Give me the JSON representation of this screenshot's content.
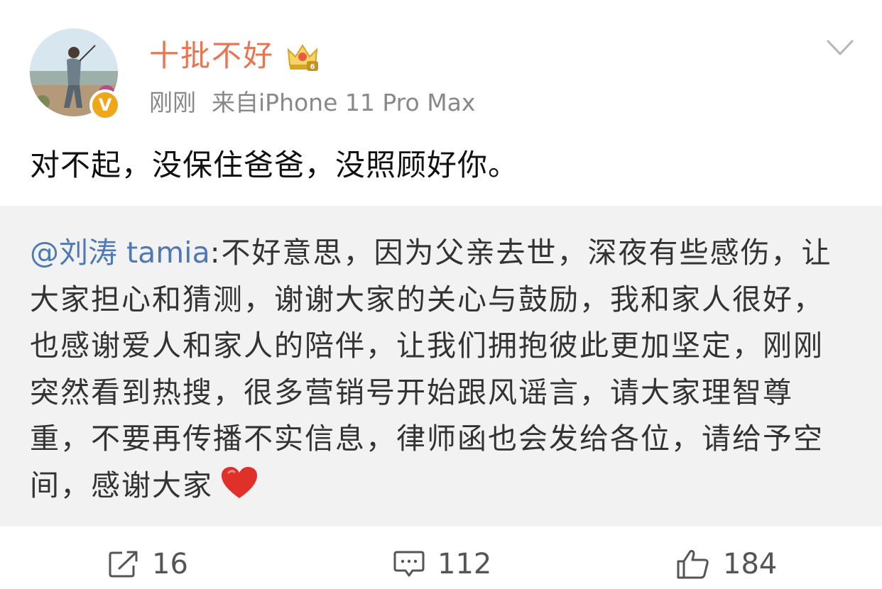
{
  "post": {
    "username": "十批不好",
    "vip_icon": "crown-vip-icon",
    "verified_icon": "verified-v-icon",
    "timestamp": "刚刚",
    "source": "来自iPhone 11 Pro Max",
    "text": "对不起，没保住爸爸，没照顾好你。"
  },
  "retweet": {
    "mention": "@刘涛 tamia",
    "separator": ":",
    "text": "不好意思，因为父亲去世，深夜有些感伤，让大家担心和猜测，谢谢大家的关心与鼓励，我和家人很好，也感谢爱人和家人的陪伴，让我们拥抱彼此更加坚定，刚刚突然看到热搜，很多营销号开始跟风谣言，请大家理智尊重，不要再传播不实信息，律师函也会发给各位，请给予空间，感谢大家",
    "emoji": "heart-emoji"
  },
  "actions": {
    "repost_count": "16",
    "comment_count": "112",
    "like_count": "184"
  },
  "colors": {
    "username": "#eb7350",
    "mention": "#4d7ab3",
    "retweet_bg": "#f2f2f2",
    "meta": "#888888"
  }
}
